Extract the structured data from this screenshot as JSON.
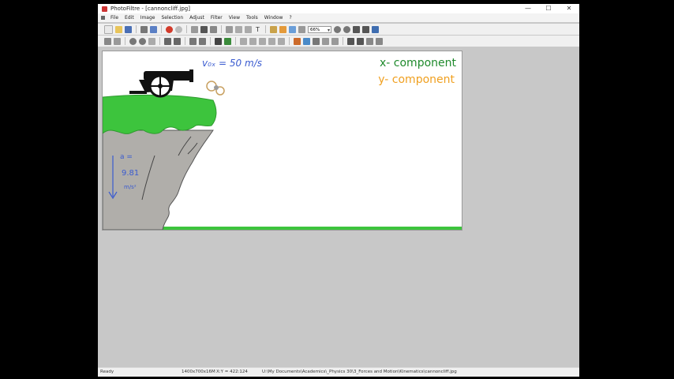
{
  "window": {
    "title": "PhotoFiltre - [cannoncliff.jpg]",
    "min": "—",
    "max": "☐",
    "close": "✕"
  },
  "menu": [
    "File",
    "Edit",
    "Image",
    "Selection",
    "Adjust",
    "Filter",
    "View",
    "Tools",
    "Window",
    "?"
  ],
  "toolbar": {
    "zoom": "66%"
  },
  "canvas": {
    "velocity_label": "v₀ₓ = 50 m/s",
    "legend_x": "x- component",
    "legend_y": "y- component",
    "accel_symbol": "a =",
    "accel_value": "9.81",
    "accel_unit": "m/s²",
    "colors": {
      "x": "#1f8a2c",
      "y": "#f0a020",
      "ink": "#3a5bd0",
      "grass": "#3dc43d",
      "rock": "#b0aeaa"
    }
  },
  "status": {
    "ready": "Ready",
    "size": "1400x700x16M",
    "coords": "X:Y = 422:124",
    "path": "U:\\My Documents\\Academics\\_Physics 30\\3_Forces and Motion\\Kinematics\\cannoncliff.jpg"
  }
}
